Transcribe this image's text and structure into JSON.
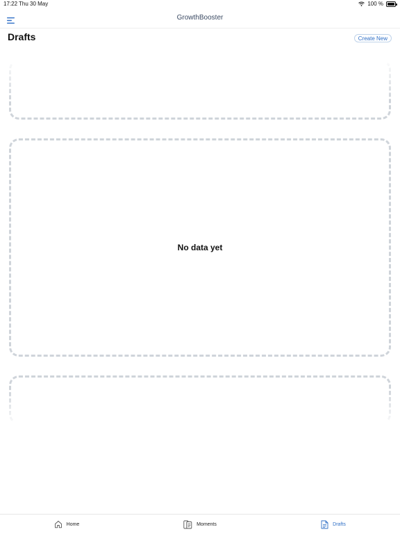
{
  "status_bar": {
    "time": "17:22",
    "date": "Thu 30 May",
    "battery": "100 %"
  },
  "app": {
    "title": "GrowthBooster"
  },
  "page": {
    "title": "Drafts",
    "create_label": "Create New"
  },
  "empty_state": {
    "message": "No data yet"
  },
  "tabs": [
    {
      "label": "Home",
      "icon": "home-icon"
    },
    {
      "label": "Moments",
      "icon": "moments-icon"
    },
    {
      "label": "Drafts",
      "icon": "document-icon",
      "active": true
    }
  ],
  "colors": {
    "accent": "#2f6fc6",
    "title_text": "#3b4a63",
    "placeholder_border": "#cfd4da"
  }
}
